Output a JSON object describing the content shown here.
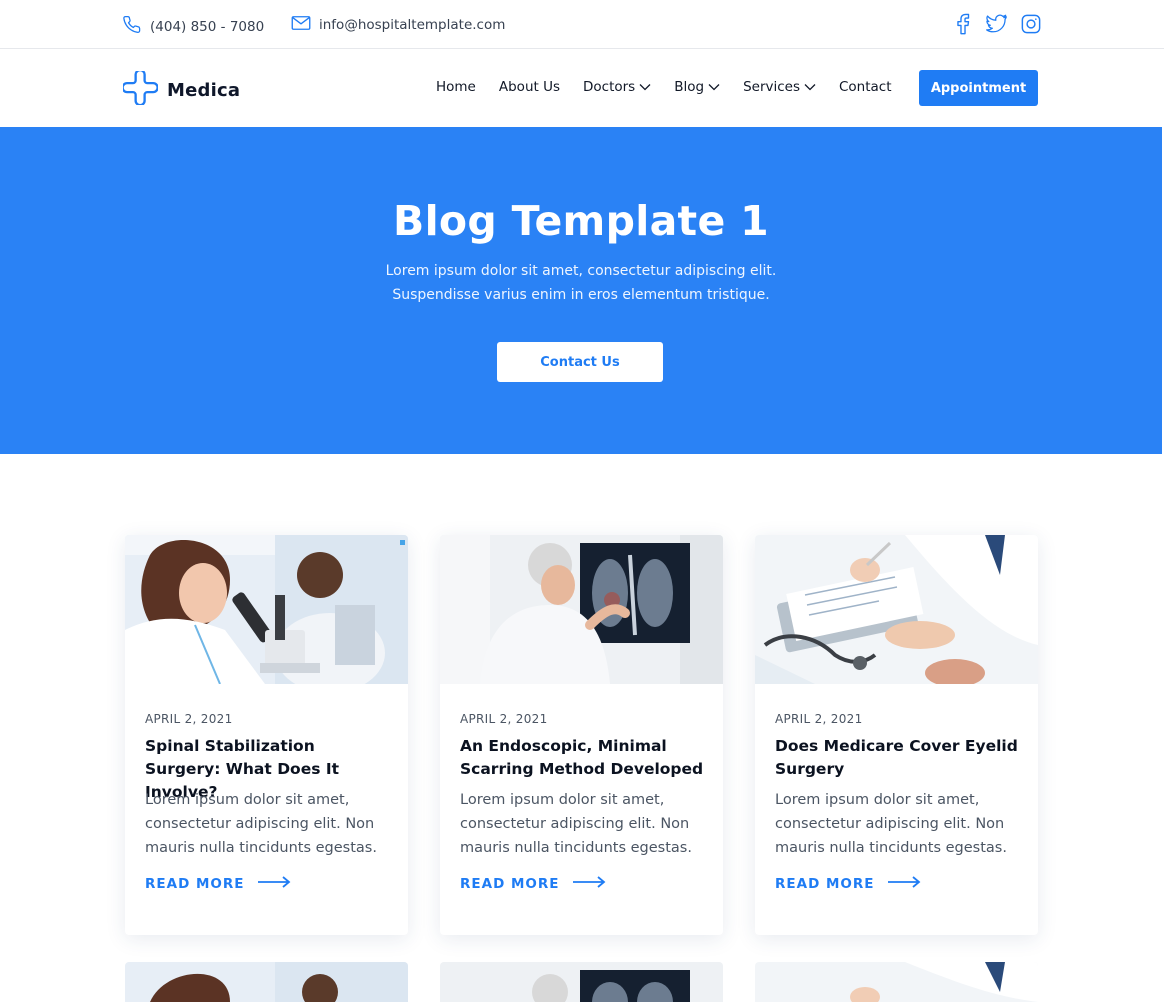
{
  "topbar": {
    "phone": "(404) 850 - 7080",
    "email": "info@hospitaltemplate.com",
    "social": [
      "facebook-icon",
      "twitter-icon",
      "instagram-icon"
    ]
  },
  "nav": {
    "logo": "Medica",
    "items": [
      {
        "label": "Home",
        "dropdown": false
      },
      {
        "label": "About Us",
        "dropdown": false
      },
      {
        "label": "Doctors",
        "dropdown": true
      },
      {
        "label": "Blog",
        "dropdown": true
      },
      {
        "label": "Services",
        "dropdown": true
      },
      {
        "label": "Contact",
        "dropdown": false
      }
    ],
    "cta": "Appointment"
  },
  "hero": {
    "title": "Blog Template 1",
    "subtitle_line1": "Lorem ipsum dolor sit amet, consectetur adipiscing elit.",
    "subtitle_line2": "Suspendisse varius enim in eros elementum tristique.",
    "button": "Contact Us"
  },
  "posts": [
    {
      "date": "APRIL 2, 2021",
      "title": "Spinal Stabilization Surgery: What Does It Involve?",
      "excerpt": "Lorem ipsum dolor sit amet, consectetur adipiscing elit. Non mauris nulla tincidunts egestas.",
      "link": "READ MORE"
    },
    {
      "date": "APRIL 2, 2021",
      "title": "An Endoscopic, Minimal Scarring Method Developed",
      "excerpt": "Lorem ipsum dolor sit amet, consectetur adipiscing elit. Non mauris nulla tincidunts egestas.",
      "link": "READ MORE"
    },
    {
      "date": "APRIL 2, 2021",
      "title": "Does Medicare Cover Eyelid Surgery",
      "excerpt": "Lorem ipsum dolor sit amet, consectetur adipiscing elit. Non mauris nulla tincidunts egestas.",
      "link": "READ MORE"
    }
  ],
  "colors": {
    "accent": "#1f7cf4",
    "hero_bg": "#2a82f5"
  }
}
